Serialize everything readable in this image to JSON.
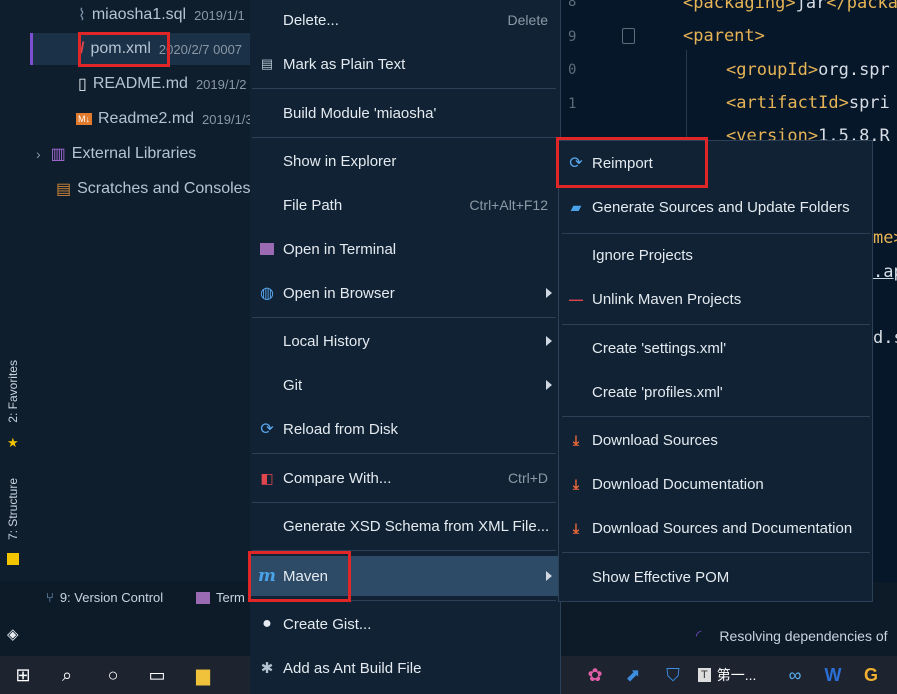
{
  "editor": {
    "line_numbers": [
      "8",
      "9",
      "0",
      "1"
    ],
    "lines": [
      {
        "open": "<packaging>",
        "text": "jar",
        "close": "</packa"
      },
      {
        "open": "<parent>",
        "text": "",
        "close": ""
      },
      {
        "open": "<groupId>",
        "text": "org.spr",
        "close": ""
      },
      {
        "open": "<artifactId>",
        "text": "spri",
        "close": ""
      },
      {
        "open": "<version>",
        "text": "1.5.8.R",
        "close": ""
      }
    ],
    "fragments": [
      "me>",
      ".ap",
      "d.s"
    ]
  },
  "tree": {
    "items": [
      {
        "label": "miaosha1.sql",
        "date": "2019/1/1"
      },
      {
        "label": "pom.xml",
        "date": "2020/2/7 0007"
      },
      {
        "label": "README.md",
        "date": "2019/1/2"
      },
      {
        "label": "Readme2.md",
        "date": "2019/1/3"
      },
      {
        "label": "External Libraries",
        "date": ""
      },
      {
        "label": "Scratches and Consoles",
        "date": ""
      }
    ]
  },
  "side_tabs": {
    "favorites": "2: Favorites",
    "structure": "7: Structure"
  },
  "status": {
    "version_control": "9: Version Control",
    "terminal": "Term",
    "resolving": "Resolving dependencies of"
  },
  "context_menu": {
    "items": [
      {
        "label": "Delete...",
        "shortcut": "Delete"
      },
      {
        "label": "Mark as Plain Text",
        "shortcut": ""
      },
      {
        "label": "Build Module 'miaosha'",
        "shortcut": ""
      },
      {
        "label": "Show in Explorer",
        "shortcut": ""
      },
      {
        "label": "File Path",
        "shortcut": "Ctrl+Alt+F12"
      },
      {
        "label": "Open in Terminal",
        "shortcut": ""
      },
      {
        "label": "Open in Browser",
        "shortcut": ""
      },
      {
        "label": "Local History",
        "shortcut": ""
      },
      {
        "label": "Git",
        "shortcut": ""
      },
      {
        "label": "Reload from Disk",
        "shortcut": ""
      },
      {
        "label": "Compare With...",
        "shortcut": "Ctrl+D"
      },
      {
        "label": "Generate XSD Schema from XML File...",
        "shortcut": ""
      },
      {
        "label": "Maven",
        "shortcut": ""
      },
      {
        "label": "Create Gist...",
        "shortcut": ""
      },
      {
        "label": "Add as Ant Build File",
        "shortcut": ""
      }
    ]
  },
  "maven_submenu": {
    "items": [
      {
        "label": "Reimport"
      },
      {
        "label": "Generate Sources and Update Folders"
      },
      {
        "label": "Ignore Projects"
      },
      {
        "label": "Unlink Maven Projects"
      },
      {
        "label": "Create 'settings.xml'"
      },
      {
        "label": "Create 'profiles.xml'"
      },
      {
        "label": "Download Sources"
      },
      {
        "label": "Download Documentation"
      },
      {
        "label": "Download Sources and Documentation"
      },
      {
        "label": "Show Effective POM"
      }
    ]
  },
  "taskbar": {
    "task_label": "第一..."
  },
  "colors": {
    "highlight": "#e02626",
    "menu_bg": "#102233",
    "active_bg": "#2d4a66"
  }
}
